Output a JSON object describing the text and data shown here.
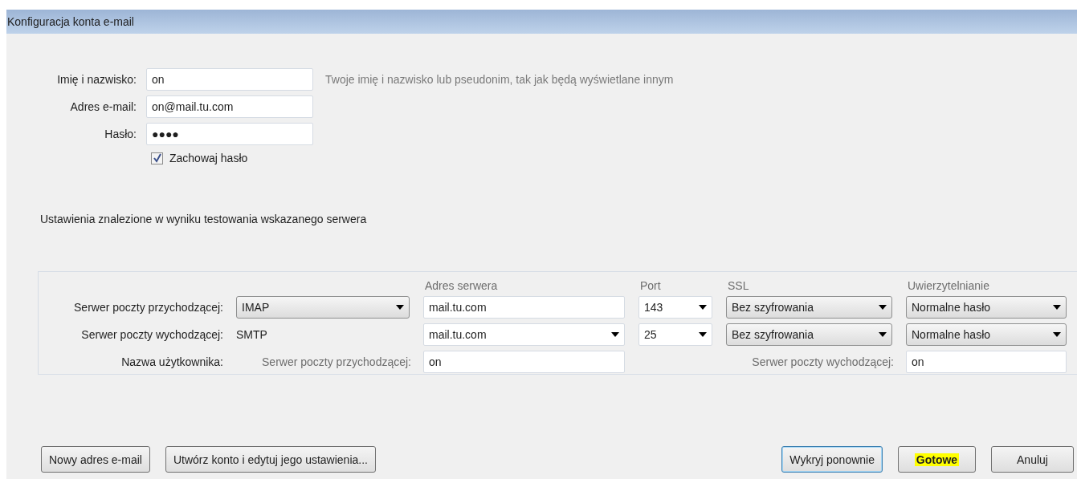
{
  "window": {
    "title": "Konfiguracja konta e-mail"
  },
  "identity": [
    {
      "label": "Imię i nazwisko:",
      "value": "on",
      "hint": "Twoje imię i nazwisko lub pseudonim, tak jak będą wyświetlane innym"
    },
    {
      "label": "Adres e-mail:",
      "value": "on@mail.tu.com"
    },
    {
      "label": "Hasło:",
      "value": "●●●●"
    }
  ],
  "remember_password": {
    "label": "Zachowaj hasło",
    "checked": true
  },
  "status_message": "Ustawienia znalezione w wyniku testowania wskazanego serwera",
  "server_settings": {
    "headers": [
      "Adres serwera",
      "Port",
      "SSL",
      "Uwierzytelnianie"
    ],
    "rows": [
      {
        "label": "Serwer poczty przychodzącej:",
        "cells": [
          {
            "kind": "select",
            "value": "IMAP"
          },
          {
            "kind": "input",
            "value": "mail.tu.com"
          },
          {
            "kind": "combo",
            "value": "143"
          },
          {
            "kind": "select",
            "value": "Bez szyfrowania"
          },
          {
            "kind": "select",
            "value": "Normalne hasło"
          }
        ]
      },
      {
        "label": "Serwer poczty wychodzącej:",
        "cells": [
          {
            "kind": "text",
            "value": "SMTP"
          },
          {
            "kind": "combo",
            "value": "mail.tu.com"
          },
          {
            "kind": "combo",
            "value": "25"
          },
          {
            "kind": "select",
            "value": "Bez szyfrowania"
          },
          {
            "kind": "select",
            "value": "Normalne hasło"
          }
        ]
      }
    ],
    "username": {
      "label": "Nazwa użytkownika:",
      "incoming_label": "Serwer poczty przychodzącej:",
      "incoming_value": "on",
      "outgoing_label": "Serwer poczty wychodzącej:",
      "outgoing_value": "on"
    }
  },
  "buttons_left": [
    {
      "label": "Nowy adres e-mail",
      "focused": false,
      "highlighted": false
    },
    {
      "label": "Utwórz konto i edytuj jego ustawienia...",
      "focused": false,
      "highlighted": false
    }
  ],
  "buttons_right": [
    {
      "label": "Wykryj ponownie",
      "focused": true,
      "highlighted": false
    },
    {
      "label": "Gotowe",
      "focused": false,
      "highlighted": true
    },
    {
      "label": "Anuluj",
      "focused": false,
      "highlighted": false
    }
  ]
}
